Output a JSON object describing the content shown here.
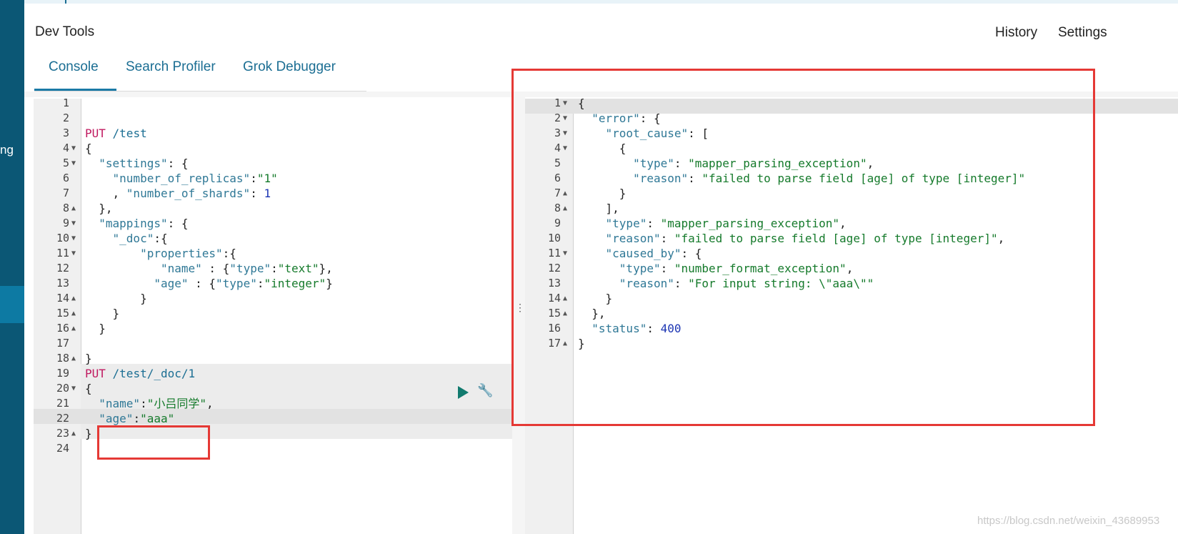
{
  "sidebar": {
    "partial_text": "ng"
  },
  "header": {
    "title": "Dev Tools",
    "history_label": "History",
    "settings_label": "Settings"
  },
  "tabs": [
    {
      "label": "Console",
      "active": true
    },
    {
      "label": "Search Profiler",
      "active": false
    },
    {
      "label": "Grok Debugger",
      "active": false
    }
  ],
  "editor": {
    "lines": [
      {
        "num": "1",
        "fold": "",
        "tokens": []
      },
      {
        "num": "2",
        "fold": "",
        "tokens": []
      },
      {
        "num": "3",
        "fold": "",
        "tokens": [
          [
            "method",
            "PUT"
          ],
          [
            "path",
            " /test"
          ]
        ]
      },
      {
        "num": "4",
        "fold": "▼",
        "tokens": [
          [
            "punc",
            "{"
          ]
        ]
      },
      {
        "num": "5",
        "fold": "▼",
        "tokens": [
          [
            "punc",
            "  "
          ],
          [
            "key",
            "\"settings\""
          ],
          [
            "punc",
            ": {"
          ]
        ]
      },
      {
        "num": "6",
        "fold": "",
        "tokens": [
          [
            "punc",
            "    "
          ],
          [
            "key",
            "\"number_of_replicas\""
          ],
          [
            "punc",
            ":"
          ],
          [
            "str",
            "\"1\""
          ]
        ]
      },
      {
        "num": "7",
        "fold": "",
        "tokens": [
          [
            "punc",
            "    , "
          ],
          [
            "key",
            "\"number_of_shards\""
          ],
          [
            "punc",
            ": "
          ],
          [
            "num",
            "1"
          ]
        ]
      },
      {
        "num": "8",
        "fold": "▲",
        "tokens": [
          [
            "punc",
            "  },"
          ]
        ]
      },
      {
        "num": "9",
        "fold": "▼",
        "tokens": [
          [
            "punc",
            "  "
          ],
          [
            "key",
            "\"mappings\""
          ],
          [
            "punc",
            ": {"
          ]
        ]
      },
      {
        "num": "10",
        "fold": "▼",
        "tokens": [
          [
            "punc",
            "    "
          ],
          [
            "key",
            "\"_doc\""
          ],
          [
            "punc",
            ":{"
          ]
        ]
      },
      {
        "num": "11",
        "fold": "▼",
        "tokens": [
          [
            "punc",
            "        "
          ],
          [
            "key",
            "\"properties\""
          ],
          [
            "punc",
            ":{"
          ]
        ]
      },
      {
        "num": "12",
        "fold": "",
        "tokens": [
          [
            "punc",
            "           "
          ],
          [
            "key",
            "\"name\""
          ],
          [
            "punc",
            " : {"
          ],
          [
            "key",
            "\"type\""
          ],
          [
            "punc",
            ":"
          ],
          [
            "str",
            "\"text\""
          ],
          [
            "punc",
            "},"
          ]
        ]
      },
      {
        "num": "13",
        "fold": "",
        "tokens": [
          [
            "punc",
            "          "
          ],
          [
            "key",
            "\"age\""
          ],
          [
            "punc",
            " : {"
          ],
          [
            "key",
            "\"type\""
          ],
          [
            "punc",
            ":"
          ],
          [
            "str",
            "\"integer\""
          ],
          [
            "punc",
            "}"
          ]
        ]
      },
      {
        "num": "14",
        "fold": "▲",
        "tokens": [
          [
            "punc",
            "        }"
          ]
        ]
      },
      {
        "num": "15",
        "fold": "▲",
        "tokens": [
          [
            "punc",
            "    }"
          ]
        ]
      },
      {
        "num": "16",
        "fold": "▲",
        "tokens": [
          [
            "punc",
            "  }"
          ]
        ]
      },
      {
        "num": "17",
        "fold": "",
        "tokens": []
      },
      {
        "num": "18",
        "fold": "▲",
        "tokens": [
          [
            "punc",
            "}"
          ]
        ]
      },
      {
        "num": "19",
        "fold": "",
        "tokens": [
          [
            "method",
            "PUT"
          ],
          [
            "path",
            " /test/_doc/1"
          ]
        ]
      },
      {
        "num": "20",
        "fold": "▼",
        "tokens": [
          [
            "punc",
            "{"
          ]
        ]
      },
      {
        "num": "21",
        "fold": "",
        "tokens": [
          [
            "punc",
            "  "
          ],
          [
            "key",
            "\"name\""
          ],
          [
            "punc",
            ":"
          ],
          [
            "str",
            "\"小吕同学\""
          ],
          [
            "punc",
            ","
          ]
        ]
      },
      {
        "num": "22",
        "fold": "",
        "tokens": [
          [
            "punc",
            "  "
          ],
          [
            "key",
            "\"age\""
          ],
          [
            "punc",
            ":"
          ],
          [
            "str",
            "\"aaa\""
          ]
        ]
      },
      {
        "num": "23",
        "fold": "▲",
        "tokens": [
          [
            "punc",
            "}"
          ]
        ]
      },
      {
        "num": "24",
        "fold": "",
        "tokens": []
      }
    ]
  },
  "output": {
    "lines": [
      {
        "num": "1",
        "fold": "▼",
        "tokens": [
          [
            "punc",
            "{"
          ]
        ]
      },
      {
        "num": "2",
        "fold": "▼",
        "tokens": [
          [
            "punc",
            "  "
          ],
          [
            "key",
            "\"error\""
          ],
          [
            "punc",
            ": {"
          ]
        ]
      },
      {
        "num": "3",
        "fold": "▼",
        "tokens": [
          [
            "punc",
            "    "
          ],
          [
            "key",
            "\"root_cause\""
          ],
          [
            "punc",
            ": ["
          ]
        ]
      },
      {
        "num": "4",
        "fold": "▼",
        "tokens": [
          [
            "punc",
            "      {"
          ]
        ]
      },
      {
        "num": "5",
        "fold": "",
        "tokens": [
          [
            "punc",
            "        "
          ],
          [
            "key",
            "\"type\""
          ],
          [
            "punc",
            ": "
          ],
          [
            "str",
            "\"mapper_parsing_exception\""
          ],
          [
            "punc",
            ","
          ]
        ]
      },
      {
        "num": "6",
        "fold": "",
        "tokens": [
          [
            "punc",
            "        "
          ],
          [
            "key",
            "\"reason\""
          ],
          [
            "punc",
            ": "
          ],
          [
            "str",
            "\"failed to parse field [age] of type [integer]\""
          ]
        ]
      },
      {
        "num": "7",
        "fold": "▲",
        "tokens": [
          [
            "punc",
            "      }"
          ]
        ]
      },
      {
        "num": "8",
        "fold": "▲",
        "tokens": [
          [
            "punc",
            "    ],"
          ]
        ]
      },
      {
        "num": "9",
        "fold": "",
        "tokens": [
          [
            "punc",
            "    "
          ],
          [
            "key",
            "\"type\""
          ],
          [
            "punc",
            ": "
          ],
          [
            "str",
            "\"mapper_parsing_exception\""
          ],
          [
            "punc",
            ","
          ]
        ]
      },
      {
        "num": "10",
        "fold": "",
        "tokens": [
          [
            "punc",
            "    "
          ],
          [
            "key",
            "\"reason\""
          ],
          [
            "punc",
            ": "
          ],
          [
            "str",
            "\"failed to parse field [age] of type [integer]\""
          ],
          [
            "punc",
            ","
          ]
        ]
      },
      {
        "num": "11",
        "fold": "▼",
        "tokens": [
          [
            "punc",
            "    "
          ],
          [
            "key",
            "\"caused_by\""
          ],
          [
            "punc",
            ": {"
          ]
        ]
      },
      {
        "num": "12",
        "fold": "",
        "tokens": [
          [
            "punc",
            "      "
          ],
          [
            "key",
            "\"type\""
          ],
          [
            "punc",
            ": "
          ],
          [
            "str",
            "\"number_format_exception\""
          ],
          [
            "punc",
            ","
          ]
        ]
      },
      {
        "num": "13",
        "fold": "",
        "tokens": [
          [
            "punc",
            "      "
          ],
          [
            "key",
            "\"reason\""
          ],
          [
            "punc",
            ": "
          ],
          [
            "str",
            "\"For input string: \\\"aaa\\\"\""
          ]
        ]
      },
      {
        "num": "14",
        "fold": "▲",
        "tokens": [
          [
            "punc",
            "    }"
          ]
        ]
      },
      {
        "num": "15",
        "fold": "▲",
        "tokens": [
          [
            "punc",
            "  },"
          ]
        ]
      },
      {
        "num": "16",
        "fold": "",
        "tokens": [
          [
            "punc",
            "  "
          ],
          [
            "key",
            "\"status\""
          ],
          [
            "punc",
            ": "
          ],
          [
            "num",
            "400"
          ]
        ]
      },
      {
        "num": "17",
        "fold": "▲",
        "tokens": [
          [
            "punc",
            "}"
          ]
        ]
      }
    ]
  },
  "icons": {
    "run": "play-icon",
    "settings": "wrench-icon",
    "resize": "resize-handle-icon"
  },
  "watermark": "https://blog.csdn.net/weixin_43689953",
  "colors": {
    "sidebar": "#0b5775",
    "accent": "#1b6e93",
    "highlight_box": "#e53935"
  }
}
